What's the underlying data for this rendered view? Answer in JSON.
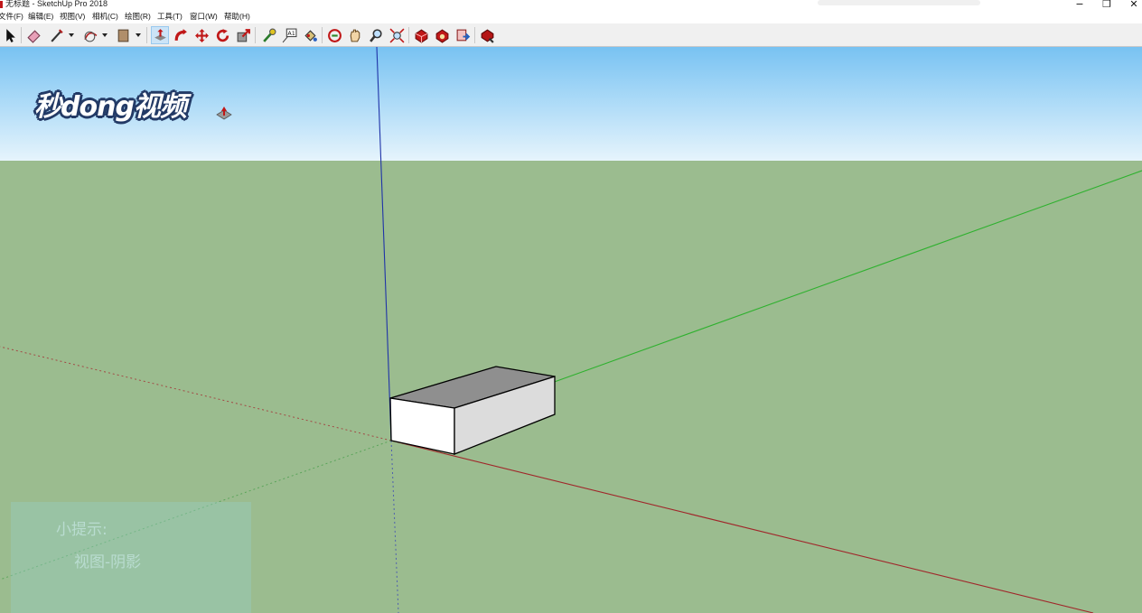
{
  "window": {
    "title": "无标题 - SketchUp Pro 2018",
    "controls": {
      "minimize": "−",
      "restore": "❐",
      "close": "✕"
    }
  },
  "menu": [
    {
      "label": "文件(F)"
    },
    {
      "label": "编辑(E)"
    },
    {
      "label": "视图(V)"
    },
    {
      "label": "相机(C)"
    },
    {
      "label": "绘图(R)"
    },
    {
      "label": "工具(T)"
    },
    {
      "label": "窗口(W)"
    },
    {
      "label": "帮助(H)"
    }
  ],
  "toolbar": {
    "tools": [
      {
        "name": "select-tool-icon"
      },
      {
        "name": "eraser-tool-icon"
      },
      {
        "name": "line-tool-icon",
        "has_dropdown": true
      },
      {
        "name": "arc-tool-icon",
        "has_dropdown": true
      },
      {
        "name": "rectangle-tool-icon",
        "has_dropdown": true
      },
      {
        "name": "push-pull-tool-icon",
        "active": true
      },
      {
        "name": "follow-me-tool-icon"
      },
      {
        "name": "move-tool-icon"
      },
      {
        "name": "rotate-tool-icon"
      },
      {
        "name": "scale-tool-icon"
      },
      {
        "name": "tape-measure-tool-icon"
      },
      {
        "name": "text-tool-icon"
      },
      {
        "name": "paint-bucket-tool-icon"
      },
      {
        "name": "orbit-tool-icon"
      },
      {
        "name": "pan-tool-icon"
      },
      {
        "name": "zoom-tool-icon"
      },
      {
        "name": "zoom-extents-tool-icon"
      },
      {
        "name": "3d-warehouse-icon"
      },
      {
        "name": "extension-warehouse-icon"
      },
      {
        "name": "send-to-layout-icon"
      },
      {
        "name": "extension-manager-icon"
      }
    ]
  },
  "watermark": {
    "text": "秒dong视频"
  },
  "tip": {
    "title": "小提示:",
    "body": "视图-阴影"
  },
  "colors": {
    "sky_top": "#78c2f2",
    "ground": "#9bbc8f",
    "axis_red": "#a0262a",
    "axis_green": "#2fb12f",
    "axis_blue": "#1f33a8",
    "box_top": "#8f8f8f",
    "box_front": "#ffffff",
    "box_side": "#dcdcdc"
  }
}
